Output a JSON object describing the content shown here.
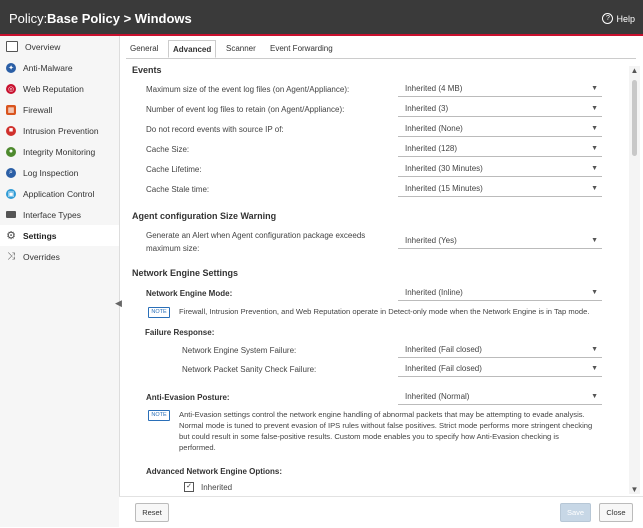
{
  "header": {
    "prefix": "Policy:",
    "title": "Base Policy > Windows",
    "help_label": "Help",
    "help_icon_glyph": "?"
  },
  "sidebar": {
    "items": [
      {
        "label": "Overview",
        "icon": "overview-icon",
        "color": "#555555"
      },
      {
        "label": "Anti-Malware",
        "icon": "anti-malware-icon",
        "color": "#2b5fa6"
      },
      {
        "label": "Web Reputation",
        "icon": "web-reputation-icon",
        "color": "#c8102e"
      },
      {
        "label": "Firewall",
        "icon": "firewall-icon",
        "color": "#d9541e"
      },
      {
        "label": "Intrusion Prevention",
        "icon": "intrusion-prevention-icon",
        "color": "#d0312d"
      },
      {
        "label": "Integrity Monitoring",
        "icon": "integrity-monitoring-icon",
        "color": "#4e8a2e"
      },
      {
        "label": "Log Inspection",
        "icon": "log-inspection-icon",
        "color": "#2b5fa6"
      },
      {
        "label": "Application Control",
        "icon": "application-control-icon",
        "color": "#2e9bd6"
      },
      {
        "label": "Interface Types",
        "icon": "interface-types-icon",
        "color": "#555555"
      },
      {
        "label": "Settings",
        "icon": "settings-icon",
        "color": "#444444"
      },
      {
        "label": "Overrides",
        "icon": "overrides-icon",
        "color": "#555555"
      }
    ]
  },
  "tabs": [
    "General",
    "Advanced",
    "Scanner",
    "Event Forwarding"
  ],
  "events": {
    "title": "Events",
    "rows": [
      {
        "label": "Maximum size of the event log files (on Agent/Appliance):",
        "value": "Inherited (4 MB)"
      },
      {
        "label": "Number of event log files to retain (on Agent/Appliance):",
        "value": "Inherited (3)"
      },
      {
        "label": "Do not record events with source IP of:",
        "value": "Inherited (None)"
      },
      {
        "label": "Cache Size:",
        "value": "Inherited (128)"
      },
      {
        "label": "Cache Lifetime:",
        "value": "Inherited (30 Minutes)"
      },
      {
        "label": "Cache Stale time:",
        "value": "Inherited (15 Minutes)"
      }
    ]
  },
  "agent_config": {
    "title": "Agent configuration Size Warning",
    "label_line1": "Generate an Alert when Agent configuration package exceeds",
    "label_line2": "maximum size:",
    "value": "Inherited (Yes)"
  },
  "network_engine": {
    "title": "Network Engine Settings",
    "mode_label": "Network Engine Mode:",
    "mode_value": "Inherited (Inline)",
    "note_badge": "NOTE",
    "mode_note": "Firewall, Intrusion Prevention, and Web Reputation operate in Detect-only mode when the Network Engine is in Tap mode.",
    "failure_title": "Failure Response:",
    "system_failure_label": "Network Engine System Failure:",
    "system_failure_value": "Inherited (Fail closed)",
    "sanity_label": "Network Packet Sanity Check Failure:",
    "sanity_value": "Inherited (Fail closed)",
    "anti_evasion_label": "Anti-Evasion Posture:",
    "anti_evasion_value": "Inherited (Normal)",
    "anti_evasion_note": [
      "Anti-Evasion settings control the network engine handling of abnormal packets that may be attempting to evade analysis.",
      "Normal mode is tuned to prevent evasion of IPS rules without false positives. Strict mode performs more stringent checking",
      "but could result in some false-positive results. Custom mode enables you to specify how Anti-Evasion checking is",
      "performed."
    ],
    "advanced_title": "Advanced Network Engine Options:",
    "inherited_label": "Inherited",
    "inherited_checked": true
  },
  "footer": {
    "reset": "Reset",
    "save": "Save",
    "close": "Close"
  },
  "colors": {
    "header_bg": "#3a3a3a",
    "accent_red": "#c8102e",
    "note_blue": "#2a6fb8",
    "save_disabled": "#c7d7e6"
  }
}
